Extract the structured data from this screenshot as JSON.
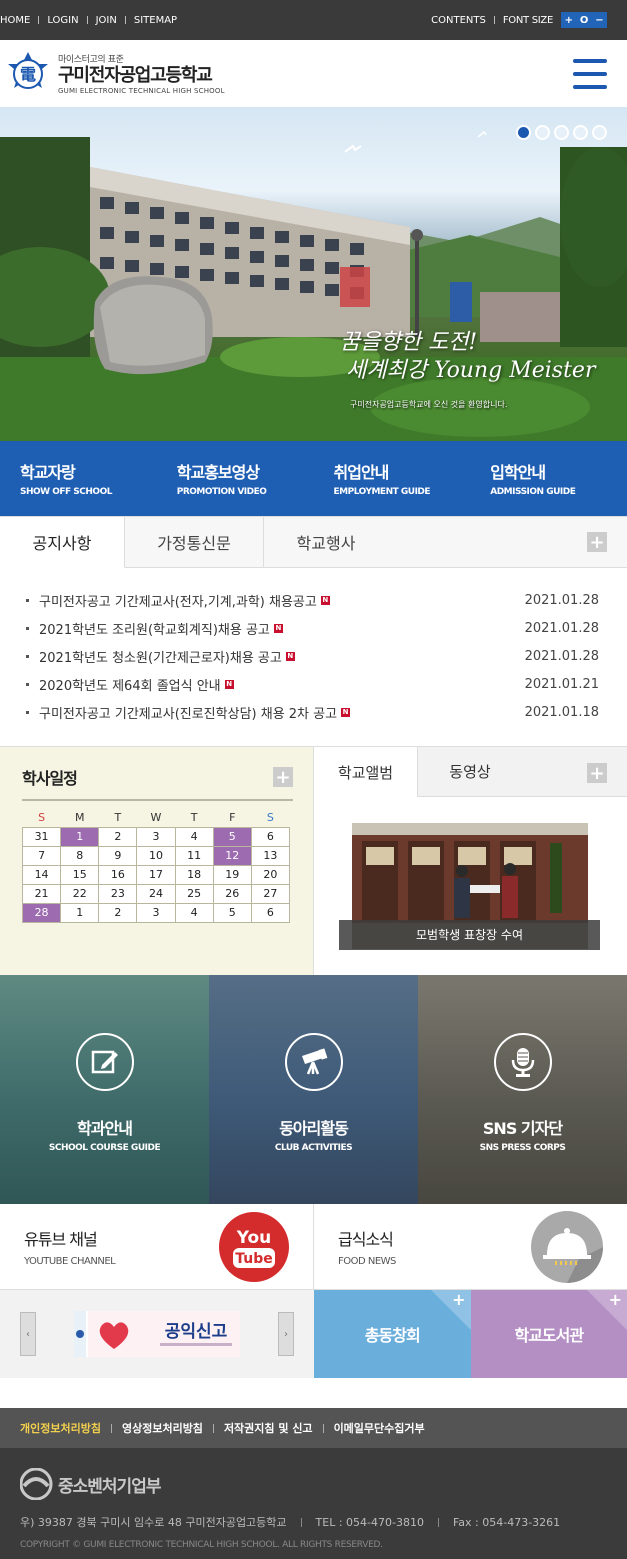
{
  "topbar": {
    "left": [
      "HOME",
      "LOGIN",
      "JOIN",
      "SITEMAP"
    ],
    "contents": "CONTENTS",
    "fontsize_label": "FONT SIZE",
    "fs_plus": "+",
    "fs_reset": "O",
    "fs_minus": "−"
  },
  "header": {
    "sub": "마이스터고의 표준",
    "name": "구미전자공업고등학교",
    "eng": "GUMI ELECTRONIC TECHNICAL HIGH SCHOOL",
    "emblem_char": "電"
  },
  "hero": {
    "slogan_1": "꿈을향한 도전!",
    "slogan_2": "세계최강 Young Meister",
    "welcome": "구미전자공업고등학교에 오신 것을 환영합니다.",
    "slide_count": 5,
    "active_slide": 1
  },
  "quick": [
    {
      "ko": "학교자랑",
      "en": "SHOW OFF SCHOOL"
    },
    {
      "ko": "학교홍보영상",
      "en": "PROMOTION VIDEO"
    },
    {
      "ko": "취업안내",
      "en": "EMPLOYMENT GUIDE"
    },
    {
      "ko": "입학안내",
      "en": "ADMISSION GUIDE"
    }
  ],
  "notice": {
    "tabs": [
      "공지사항",
      "가정통신문",
      "학교행사"
    ],
    "more": "+",
    "new_badge": "N",
    "items": [
      {
        "title": "구미전자공고 기간제교사(전자,기계,과학) 채용공고",
        "date": "2021.01.28"
      },
      {
        "title": "2021학년도 조리원(학교회계직)채용 공고",
        "date": "2021.01.28"
      },
      {
        "title": "2021학년도 청소원(기간제근로자)채용 공고",
        "date": "2021.01.28"
      },
      {
        "title": "2020학년도 제64회 졸업식 안내",
        "date": "2021.01.21"
      },
      {
        "title": "구미전자공고 기간제교사(진로진학상담) 채용 2차 공고",
        "date": "2021.01.18"
      }
    ]
  },
  "schedule": {
    "title": "학사일정",
    "more": "+",
    "weekdays": [
      "S",
      "M",
      "T",
      "W",
      "T",
      "F",
      "S"
    ],
    "weeks": [
      [
        "31",
        "1",
        "2",
        "3",
        "4",
        "5",
        "6"
      ],
      [
        "7",
        "8",
        "9",
        "10",
        "11",
        "12",
        "13"
      ],
      [
        "14",
        "15",
        "16",
        "17",
        "18",
        "19",
        "20"
      ],
      [
        "21",
        "22",
        "23",
        "24",
        "25",
        "26",
        "27"
      ],
      [
        "28",
        "1",
        "2",
        "3",
        "4",
        "5",
        "6"
      ]
    ],
    "highlighted": [
      "0-1",
      "0-5",
      "1-5",
      "4-0"
    ]
  },
  "album": {
    "tabs": [
      "학교앨범",
      "동영상"
    ],
    "more": "+",
    "caption": "모범학생 표창장 수여"
  },
  "features": [
    {
      "ko": "학과안내",
      "en": "SCHOOL COURSE GUIDE",
      "icon": "edit-icon",
      "color": "#3f6b6a"
    },
    {
      "ko": "동아리활동",
      "en": "CLUB ACTIVITIES",
      "icon": "telescope-icon",
      "color": "#3e5a78"
    },
    {
      "ko": "SNS 기자단",
      "en": "SNS PRESS CORPS",
      "icon": "microphone-icon",
      "color": "#5b5a52"
    }
  ],
  "social": [
    {
      "ko": "유튜브 채널",
      "en": "YOUTUBE CHANNEL",
      "logo_top": "You",
      "logo_bottom": "Tube"
    },
    {
      "ko": "급식소식",
      "en": "FOOD NEWS"
    }
  ],
  "banners": {
    "prev": "‹",
    "next": "›",
    "banner_text": "공익신고",
    "tiles": [
      {
        "label": "총동창회",
        "color": "#6aaedc",
        "more": "+"
      },
      {
        "label": "학교도서관",
        "color": "#b48fc4",
        "more": "+"
      }
    ]
  },
  "footer": {
    "nav": [
      "개인정보처리방침",
      "영상정보처리방침",
      "저작권지침 및 신고",
      "이메일무단수집거부"
    ],
    "ministry": "중소벤처기업부",
    "address": "우) 39387 경북 구미시 임수로 48 구미전자공업고등학교",
    "tel": "TEL : 054-470-3810",
    "fax": "Fax : 054-473-3261",
    "copyright": "COPYRIGHT © GUMI ELECTRONIC TECHNICAL HIGH SCHOOL. ALL RIGHTS RESERVED."
  }
}
